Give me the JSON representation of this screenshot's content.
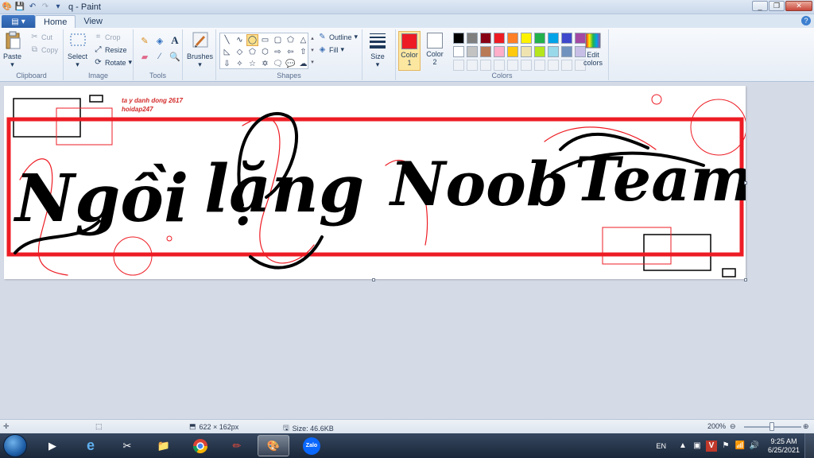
{
  "app": {
    "title": "q - Paint"
  },
  "tabs": {
    "file_label": "▾",
    "home": "Home",
    "view": "View"
  },
  "ribbon": {
    "clipboard": {
      "label": "Clipboard",
      "paste": "Paste",
      "cut": "Cut",
      "copy": "Copy"
    },
    "image": {
      "label": "Image",
      "select": "Select",
      "crop": "Crop",
      "resize": "Resize",
      "rotate": "Rotate"
    },
    "tools": {
      "label": "Tools"
    },
    "brushes": {
      "label": "Brushes"
    },
    "shapes": {
      "label": "Shapes",
      "outline": "Outline",
      "fill": "Fill"
    },
    "size": {
      "label": "Size"
    },
    "colors": {
      "label": "Colors",
      "color1_label": "Color",
      "color1_num": "1",
      "color2_label": "Color",
      "color2_num": "2",
      "edit_label": "Edit",
      "edit_label2": "colors",
      "color1": "#ed1c24",
      "color2": "#ffffff",
      "palette_row1": [
        "#000000",
        "#7f7f7f",
        "#880015",
        "#ed1c24",
        "#ff7f27",
        "#fff200",
        "#22b14c",
        "#00a2e8",
        "#3f48cc",
        "#a349a4"
      ],
      "palette_row2": [
        "#ffffff",
        "#c3c3c3",
        "#b97a57",
        "#ffaec9",
        "#ffc90e",
        "#efe4b0",
        "#b5e61d",
        "#99d9ea",
        "#7092be",
        "#c8bfe7"
      ]
    }
  },
  "canvas": {
    "credit_line1": "ta y danh dong 2617",
    "credit_line2": "hoidap247",
    "word1": "Ngồi",
    "word2": "lặng",
    "word3": "Noob",
    "word4": "Team"
  },
  "status": {
    "dimensions": "622 × 162px",
    "size": "Size: 46.6KB",
    "zoom": "200%"
  },
  "taskbar": {
    "lang": "EN",
    "zalo": "Zalo",
    "time": "9:25 AM",
    "date": "6/25/2021"
  }
}
